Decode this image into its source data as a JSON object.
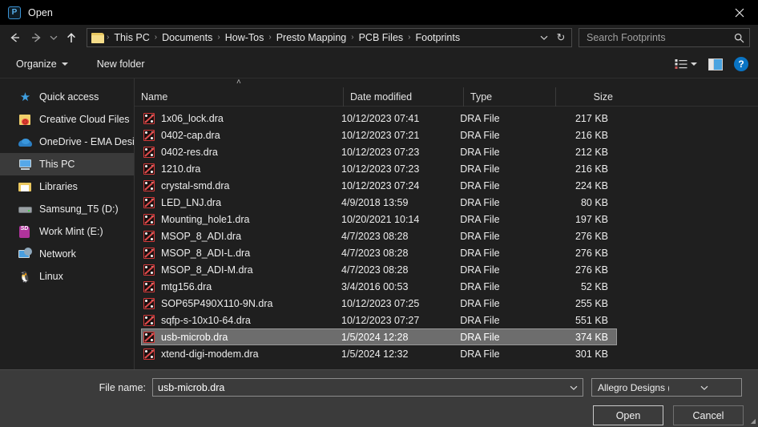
{
  "window": {
    "title": "Open",
    "app_icon": "presto-app-icon",
    "close_label": "✕"
  },
  "nav": {
    "back_icon": "back-arrow-icon",
    "forward_icon": "forward-arrow-icon",
    "recent_icon": "chevron-down-icon",
    "up_icon": "up-arrow-icon"
  },
  "address": {
    "folder_icon": "folder-icon",
    "crumbs": [
      "This PC",
      "Documents",
      "How-Tos",
      "Presto Mapping",
      "PCB Files",
      "Footprints"
    ],
    "separator": "›",
    "dropdown_icon": "chevron-down-icon",
    "refresh_icon": "↻"
  },
  "search": {
    "placeholder": "Search Footprints",
    "value": "",
    "icon": "search-icon"
  },
  "toolbar": {
    "organize_label": "Organize",
    "new_folder_label": "New folder",
    "view_icon": "view-list-icon",
    "preview_pane_icon": "preview-pane-icon",
    "help_label": "?"
  },
  "sidebar": {
    "items": [
      {
        "label": "Quick access",
        "icon": "star-icon",
        "selected": false
      },
      {
        "label": "Creative Cloud Files",
        "icon": "creative-cloud-folder-icon",
        "selected": false
      },
      {
        "label": "OneDrive - EMA Desi",
        "icon": "onedrive-cloud-icon",
        "selected": false
      },
      {
        "label": "This PC",
        "icon": "this-pc-monitor-icon",
        "selected": true
      },
      {
        "label": "Libraries",
        "icon": "libraries-folder-icon",
        "selected": false
      },
      {
        "label": "Samsung_T5 (D:)",
        "icon": "drive-icon",
        "selected": false
      },
      {
        "label": "Work Mint (E:)",
        "icon": "sd-card-icon",
        "selected": false
      },
      {
        "label": "Network",
        "icon": "network-icon",
        "selected": false
      },
      {
        "label": "Linux",
        "icon": "linux-penguin-icon",
        "selected": false
      }
    ]
  },
  "filelist": {
    "sort_indicator": "˄",
    "columns": [
      "Name",
      "Date modified",
      "Type",
      "Size"
    ],
    "rows": [
      {
        "name": "1x06_lock.dra",
        "date": "10/12/2023 07:41",
        "type": "DRA File",
        "size": "217 KB",
        "selected": false
      },
      {
        "name": "0402-cap.dra",
        "date": "10/12/2023 07:21",
        "type": "DRA File",
        "size": "216 KB",
        "selected": false
      },
      {
        "name": "0402-res.dra",
        "date": "10/12/2023 07:23",
        "type": "DRA File",
        "size": "212 KB",
        "selected": false
      },
      {
        "name": "1210.dra",
        "date": "10/12/2023 07:23",
        "type": "DRA File",
        "size": "216 KB",
        "selected": false
      },
      {
        "name": "crystal-smd.dra",
        "date": "10/12/2023 07:24",
        "type": "DRA File",
        "size": "224 KB",
        "selected": false
      },
      {
        "name": "LED_LNJ.dra",
        "date": "4/9/2018 13:59",
        "type": "DRA File",
        "size": "80 KB",
        "selected": false
      },
      {
        "name": "Mounting_hole1.dra",
        "date": "10/20/2021 10:14",
        "type": "DRA File",
        "size": "197 KB",
        "selected": false
      },
      {
        "name": "MSOP_8_ADI.dra",
        "date": "4/7/2023 08:28",
        "type": "DRA File",
        "size": "276 KB",
        "selected": false
      },
      {
        "name": "MSOP_8_ADI-L.dra",
        "date": "4/7/2023 08:28",
        "type": "DRA File",
        "size": "276 KB",
        "selected": false
      },
      {
        "name": "MSOP_8_ADI-M.dra",
        "date": "4/7/2023 08:28",
        "type": "DRA File",
        "size": "276 KB",
        "selected": false
      },
      {
        "name": "mtg156.dra",
        "date": "3/4/2016 00:53",
        "type": "DRA File",
        "size": "52 KB",
        "selected": false
      },
      {
        "name": "SOP65P490X110-9N.dra",
        "date": "10/12/2023 07:25",
        "type": "DRA File",
        "size": "255 KB",
        "selected": false
      },
      {
        "name": "sqfp-s-10x10-64.dra",
        "date": "10/12/2023 07:27",
        "type": "DRA File",
        "size": "551 KB",
        "selected": false
      },
      {
        "name": "usb-microb.dra",
        "date": "1/5/2024 12:28",
        "type": "DRA File",
        "size": "374 KB",
        "selected": true
      },
      {
        "name": "xtend-digi-modem.dra",
        "date": "1/5/2024 12:32",
        "type": "DRA File",
        "size": "301 KB",
        "selected": false
      }
    ]
  },
  "footer": {
    "filename_label": "File name:",
    "filename_value": "usb-microb.dra",
    "filename_dropdown_icon": "chevron-down-icon",
    "filter_value": "Allegro Designs (*.dra *.brd)",
    "filter_dropdown_icon": "chevron-down-icon",
    "open_label": "Open",
    "cancel_label": "Cancel",
    "resize_grip": "◢"
  },
  "colors": {
    "window_bg": "#1f1f1f",
    "titlebar_bg": "#000000",
    "footer_bg": "#3b3b3b",
    "selection_bg": "#6d6d6d",
    "accent_blue": "#0a74c4",
    "file_icon_red": "#d33a3a",
    "folder_yellow": "#f0cf6a"
  }
}
